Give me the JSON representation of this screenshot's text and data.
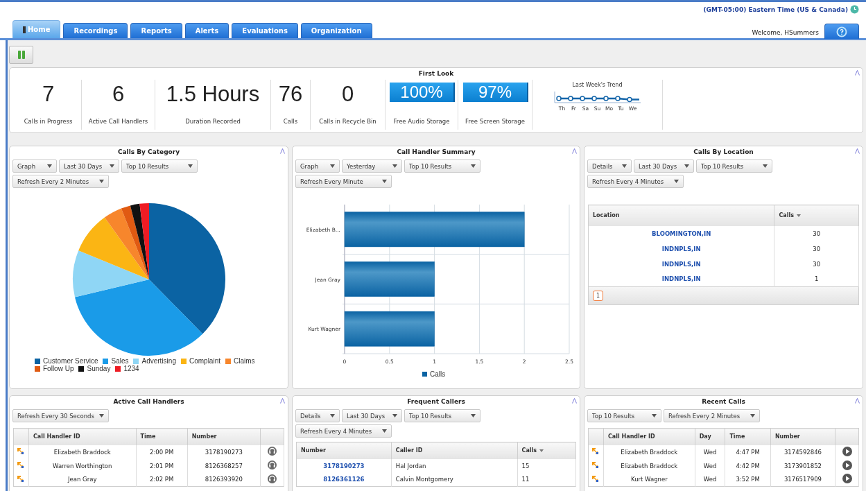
{
  "header": {
    "timezone": "(GMT-05:00) Eastern Time (US & Canada)",
    "welcome": "Welcome, HSummers"
  },
  "tabs": [
    {
      "label": "Home",
      "selected": true
    },
    {
      "label": "Recordings",
      "selected": false
    },
    {
      "label": "Reports",
      "selected": false
    },
    {
      "label": "Alerts",
      "selected": false
    },
    {
      "label": "Evaluations",
      "selected": false
    },
    {
      "label": "Organization",
      "selected": false
    }
  ],
  "first_look": {
    "title": "First Look",
    "stats": [
      {
        "kind": "number",
        "value": "7",
        "label": "Calls in Progress"
      },
      {
        "kind": "number",
        "value": "6",
        "label": "Active Call Handlers"
      },
      {
        "kind": "number",
        "value": "1.5 Hours",
        "label": "Duration Recorded"
      },
      {
        "kind": "number",
        "value": "76",
        "label": "Calls"
      },
      {
        "kind": "number",
        "value": "0",
        "label": "Calls in Recycle Bin"
      },
      {
        "kind": "storage",
        "value": "100%",
        "label": "Free Audio Storage"
      },
      {
        "kind": "storage",
        "value": "97%",
        "label": "Free Screen Storage"
      }
    ],
    "trend": {
      "title": "Last Week's Trend",
      "days": [
        "Th",
        "Fr",
        "Sa",
        "Su",
        "Mo",
        "Tu",
        "We"
      ]
    }
  },
  "panels": [
    {
      "kind": "pie",
      "title": "Calls By Category",
      "filters": [
        "Graph",
        "Last 30 Days",
        "Top 10 Results",
        "Refresh Every 2 Minutes"
      ],
      "chart_data": {
        "type": "pie",
        "categories": [
          "Customer Service",
          "Sales",
          "Advertising",
          "Complaint",
          "Claims",
          "Follow Up",
          "Sunday",
          "1234"
        ],
        "values": [
          38,
          34,
          10,
          9,
          4,
          2,
          2,
          2
        ],
        "colors": [
          "#0b63a3",
          "#1a9be8",
          "#8fd6f5",
          "#fbb514",
          "#f7862c",
          "#e05a12",
          "#111111",
          "#ee1c24"
        ]
      }
    },
    {
      "kind": "bar",
      "title": "Call Handler Summary",
      "filters": [
        "Graph",
        "Yesterday",
        "Top 10 Results",
        "Refresh Every Minute"
      ],
      "chart_data": {
        "type": "bar",
        "orientation": "horizontal",
        "categories": [
          "Elizabeth B...",
          "Jean Gray",
          "Kurt Wagner"
        ],
        "series": [
          {
            "name": "Calls",
            "color": "#0b63a3",
            "values": [
              2,
              1,
              1
            ]
          }
        ],
        "grid": true,
        "xlim": [
          0,
          2.5
        ],
        "xticks": [
          0,
          0.5,
          1,
          1.5,
          2,
          2.5
        ]
      }
    },
    {
      "kind": "table",
      "title": "Calls By Location",
      "filters": [
        "Details",
        "Last 30 Days",
        "Top 10 Results",
        "Refresh Every 4 Minutes"
      ],
      "table": {
        "kind": "plain",
        "columns": [
          {
            "label": "Location",
            "sorted": false,
            "link": true
          },
          {
            "label": "Calls",
            "sorted": true,
            "link": false
          }
        ],
        "rows": [
          [
            "BLOOMINGTON,IN",
            "30"
          ],
          [
            "INDNPLS,IN",
            "30"
          ],
          [
            "INDNPLS,IN",
            "30"
          ],
          [
            "INDNPLS,IN",
            "1"
          ]
        ],
        "pages": [
          {
            "label": "1",
            "selected": true
          }
        ]
      }
    },
    {
      "kind": "table",
      "title": "Active Call Handlers",
      "filters": [
        "Refresh Every 30 Seconds"
      ],
      "table": {
        "kind": "live",
        "columns": [
          {
            "label": "Call Handler ID",
            "sorted": false,
            "link": false
          },
          {
            "label": "Time",
            "sorted": false,
            "link": false
          },
          {
            "label": "Number",
            "sorted": false,
            "link": false
          }
        ],
        "rows": [
          [
            "Elizabeth Braddock",
            "2:00 PM",
            "3178190273"
          ],
          [
            "Warren Worthington",
            "2:01 PM",
            "8126368257"
          ],
          [
            "Jean Gray",
            "2:02 PM",
            "8126393920"
          ]
        ]
      }
    },
    {
      "kind": "table",
      "title": "Frequent Callers",
      "filters": [
        "Details",
        "Last 30 Days",
        "Top 10 Results",
        "Refresh Every 4 Minutes"
      ],
      "table": {
        "kind": "plain",
        "columns": [
          {
            "label": "Number",
            "sorted": false,
            "link": true
          },
          {
            "label": "Caller ID",
            "sorted": false,
            "link": false
          },
          {
            "label": "Calls",
            "sorted": true,
            "link": false
          }
        ],
        "rows": [
          [
            "3178190273",
            "Hal Jordan",
            "15"
          ],
          [
            "8126361126",
            "Calvin Montgomery",
            "11"
          ]
        ]
      }
    },
    {
      "kind": "table",
      "title": "Recent Calls",
      "filters": [
        "Top 10 Results",
        "Refresh Every 2 Minutes"
      ],
      "table": {
        "kind": "recorded",
        "columns": [
          {
            "label": "Call Handler ID",
            "sorted": false,
            "link": false
          },
          {
            "label": "Day",
            "sorted": false,
            "link": false
          },
          {
            "label": "Time",
            "sorted": false,
            "link": false
          },
          {
            "label": "Number",
            "sorted": false,
            "link": false
          }
        ],
        "rows": [
          [
            "Elizabeth Braddock",
            "Wed",
            "4:47 PM",
            "3174592846"
          ],
          [
            "Elizabeth Braddock",
            "Wed",
            "4:42 PM",
            "3173901852"
          ],
          [
            "Kurt Wagner",
            "Wed",
            "3:52 PM",
            "3176517909"
          ]
        ]
      }
    }
  ]
}
